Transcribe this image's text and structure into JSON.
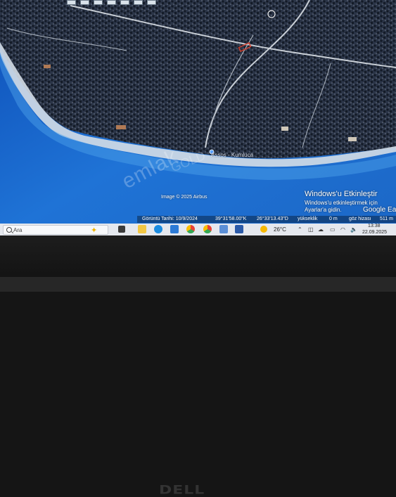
{
  "map": {
    "watermark_primary": "emlak",
    "watermark_secondary": "GOLD",
    "place_label": "Assos - Kumluca",
    "imagery_credit": "Image © 2025 Airbus",
    "brand": "Google Earth"
  },
  "status": {
    "imagery_date": "Görüntü Tarihi: 10/9/2024",
    "latitude": "39°31'58.00\"K",
    "longitude": "26°33'13.43\"D",
    "elevation_label": "yükseklik",
    "elevation_value": "0 m",
    "eye_altitude_label": "göz hizası",
    "eye_altitude_value": "511 m"
  },
  "activation": {
    "title": "Windows'u Etkinleştir",
    "line1": "Windows'u etkinleştirmek için",
    "line2": "Ayarlar'a gidin."
  },
  "taskbar": {
    "search_placeholder": "Ara",
    "weather_temp": "26°C",
    "time": "13:38",
    "date": "22.09.2025",
    "app_icons": [
      "task-view-icon",
      "file-explorer-icon",
      "edge-icon",
      "mail-icon",
      "chrome-icon",
      "chrome-alt-icon",
      "people-icon",
      "photos-icon"
    ]
  },
  "hardware": {
    "logo": "DELL"
  },
  "colors": {
    "sea": "#1e6fd0",
    "land": "#2a3446",
    "beach": "#cfd8e2",
    "taskbar": "#e5e8ee"
  }
}
